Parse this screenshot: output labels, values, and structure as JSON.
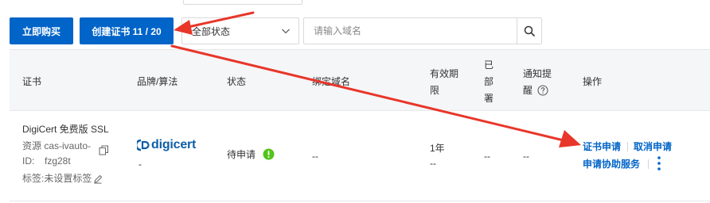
{
  "toolbar": {
    "buy_label": "立即购买",
    "create_label": "创建证书 11 / 20",
    "status_select": {
      "value": "全部状态"
    },
    "search": {
      "placeholder": "请输入域名",
      "value": ""
    }
  },
  "table": {
    "headers": {
      "cert": "证书",
      "brand": "品牌/算法",
      "status": "状态",
      "domain": "绑定域名",
      "validity_1": "有效期",
      "validity_2": "限",
      "deployed_1": "已",
      "deployed_2": "部",
      "deployed_3": "署",
      "notify_1": "通知提",
      "notify_2": "醒",
      "actions": "操作"
    },
    "row": {
      "cert_name": "DigiCert 免费版 SSL",
      "resource_line1": "资源  cas-ivauto-",
      "resource_label": "ID:",
      "resource_id": "fzg28t",
      "tag_label": "标签:未设置标签",
      "brand_logo_text": "digicert",
      "brand_algo": "-",
      "status_text": "待申请",
      "domain": "--",
      "validity_value": "1年",
      "validity_sub": "--",
      "deployed": "--",
      "notify": "--",
      "actions": {
        "apply": "证书申请",
        "cancel": "取消申请",
        "assist": "申请协助服务"
      }
    }
  },
  "colors": {
    "primary": "#0064c8",
    "status_ok": "#52c41a",
    "digicert_blue": "#0f5fa8",
    "annotation_red": "#e8362a"
  }
}
